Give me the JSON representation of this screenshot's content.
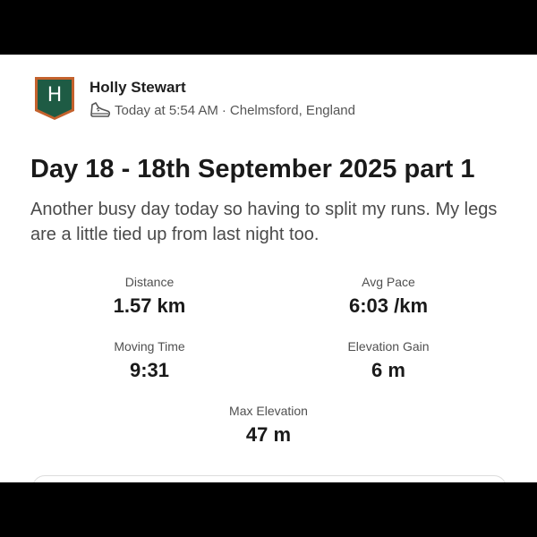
{
  "athlete": {
    "avatar_letter": "H",
    "name": "Holly Stewart",
    "timestamp": "Today at 5:54 AM",
    "separator": "·",
    "location": "Chelmsford, England",
    "activity_icon": "shoe-icon",
    "avatar_color": "#1e5b44",
    "avatar_border_color": "#c4622d"
  },
  "activity": {
    "title": "Day 18 - 18th September 2025 part 1",
    "description": "Another busy day today so having to split my runs. My legs are a little tied up from last night too."
  },
  "stats": {
    "distance": {
      "label": "Distance",
      "value": "1.57 km"
    },
    "avg_pace": {
      "label": "Avg Pace",
      "value": "6:03 /km"
    },
    "moving_time": {
      "label": "Moving Time",
      "value": "9:31"
    },
    "elevation_gain": {
      "label": "Elevation Gain",
      "value": "6 m"
    },
    "max_elevation": {
      "label": "Max Elevation",
      "value": "47 m"
    }
  }
}
